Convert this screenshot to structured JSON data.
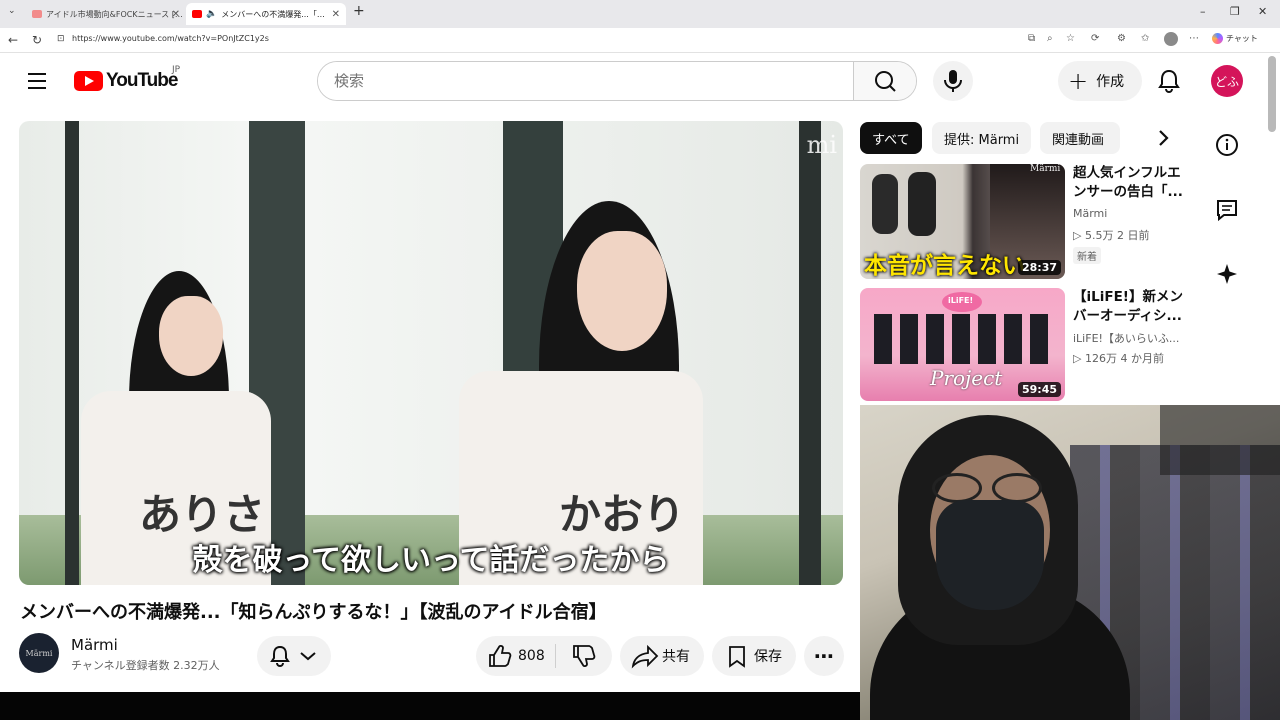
{
  "browser": {
    "tabs": [
      {
        "title": "アイドル市場動向&FOCKニュース [詳細]",
        "active": false
      },
      {
        "title": "メンバーへの不満爆発...「知らんぷ...",
        "active": true
      }
    ],
    "new_tab": "+",
    "url": "https://www.youtube.com/watch?v=POnJtZC1y2s",
    "copilot_label": "チャット"
  },
  "youtube": {
    "logo_text": "YouTube",
    "region": "JP",
    "search_placeholder": "検索",
    "create_label": "作成",
    "avatar_text": "どふ"
  },
  "video": {
    "title": "メンバーへの不満爆発...「知らんぷりするな！」【波乱のアイドル合宿】",
    "subtitle": "殻を破って欲しいって話だったから",
    "watermark": "mi",
    "nametag_left": "ありさ",
    "nametag_right": "かおり",
    "channel_name": "Märmi",
    "channel_subs": "チャンネル登録者数 2.32万人",
    "channel_avatar_text": "Märmi",
    "like_count": "808",
    "share_label": "共有",
    "save_label": "保存"
  },
  "chips": [
    "すべて",
    "提供: Märmi",
    "関連動画"
  ],
  "related": [
    {
      "title": "超人気インフルエンサーの告白「...",
      "channel": "Märmi",
      "meta": "▷ 5.5万  2 日前",
      "badge": "新着",
      "duration": "28:37",
      "thumb_text": "本音が言えない",
      "thumb_mark": "Märmi"
    },
    {
      "title": "【iLiFE!】新メンバーオーディシ...",
      "channel": "iLiFE!【あいらいふ...",
      "meta": "▷ 126万  4 か月前",
      "badge": "",
      "duration": "59:45",
      "thumb_text": "Project",
      "thumb_mark": "iLiFE!"
    }
  ],
  "colors": {
    "brand_red": "#ff0000",
    "avatar_pink": "#d4145a",
    "chip_selected": "#0f0f0f"
  }
}
